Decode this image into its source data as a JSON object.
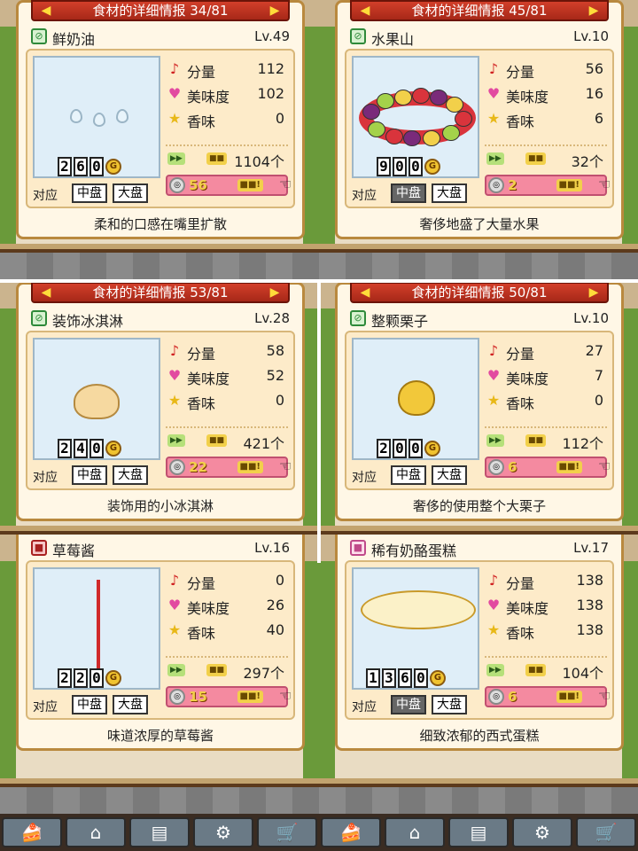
{
  "cards": [
    {
      "header": "食材的详细情报 34/81",
      "name": "鲜奶油",
      "level": "Lv.49",
      "name_icon_color": "green",
      "price_digits": [
        "2",
        "6",
        "0"
      ],
      "stats": [
        {
          "label": "分量",
          "value": "112",
          "icon": "note-icon"
        },
        {
          "label": "美味度",
          "value": "102",
          "icon": "heart-icon"
        },
        {
          "label": "香味",
          "value": "0",
          "icon": "star-icon"
        }
      ],
      "stock": "1104个",
      "medal": "56",
      "plate_label": "对应",
      "plates": [
        {
          "label": "中盘",
          "active": false
        },
        {
          "label": "大盘",
          "active": false
        }
      ],
      "description": "柔和的口感在嘴里扩散",
      "art": "cream"
    },
    {
      "header": "食材的详细情报 45/81",
      "name": "水果山",
      "level": "Lv.10",
      "name_icon_color": "green",
      "price_digits": [
        "9",
        "0",
        "0"
      ],
      "stats": [
        {
          "label": "分量",
          "value": "56",
          "icon": "note-icon"
        },
        {
          "label": "美味度",
          "value": "16",
          "icon": "heart-icon"
        },
        {
          "label": "香味",
          "value": "6",
          "icon": "star-icon"
        }
      ],
      "stock": "32个",
      "medal": "2",
      "plate_label": "对应",
      "plates": [
        {
          "label": "中盘",
          "active": true
        },
        {
          "label": "大盘",
          "active": false
        }
      ],
      "description": "奢侈地盛了大量水果",
      "art": "fruit-ring"
    },
    {
      "header": "食材的详细情报 53/81",
      "name": "装饰冰淇淋",
      "level": "Lv.28",
      "name_icon_color": "green",
      "price_digits": [
        "2",
        "4",
        "0"
      ],
      "stats": [
        {
          "label": "分量",
          "value": "58",
          "icon": "note-icon"
        },
        {
          "label": "美味度",
          "value": "52",
          "icon": "heart-icon"
        },
        {
          "label": "香味",
          "value": "0",
          "icon": "star-icon"
        }
      ],
      "stock": "421个",
      "medal": "22",
      "plate_label": "对应",
      "plates": [
        {
          "label": "中盘",
          "active": false
        },
        {
          "label": "大盘",
          "active": false
        }
      ],
      "description": "装饰用的小冰淇淋",
      "art": "ice-cream"
    },
    {
      "header": "食材的详细情报 50/81",
      "name": "整颗栗子",
      "level": "Lv.10",
      "name_icon_color": "green",
      "price_digits": [
        "2",
        "0",
        "0"
      ],
      "stats": [
        {
          "label": "分量",
          "value": "27",
          "icon": "note-icon"
        },
        {
          "label": "美味度",
          "value": "7",
          "icon": "heart-icon"
        },
        {
          "label": "香味",
          "value": "0",
          "icon": "star-icon"
        }
      ],
      "stock": "112个",
      "medal": "6",
      "plate_label": "对应",
      "plates": [
        {
          "label": "中盘",
          "active": false
        },
        {
          "label": "大盘",
          "active": false
        }
      ],
      "description": "奢侈的使用整个大栗子",
      "art": "chestnut"
    },
    {
      "header": "",
      "name": "草莓酱",
      "level": "Lv.16",
      "name_icon_color": "red",
      "price_digits": [
        "2",
        "2",
        "0"
      ],
      "stats": [
        {
          "label": "分量",
          "value": "0",
          "icon": "note-icon"
        },
        {
          "label": "美味度",
          "value": "26",
          "icon": "heart-icon"
        },
        {
          "label": "香味",
          "value": "40",
          "icon": "star-icon"
        }
      ],
      "stock": "297个",
      "medal": "15",
      "plate_label": "对应",
      "plates": [
        {
          "label": "中盘",
          "active": false
        },
        {
          "label": "大盘",
          "active": false
        }
      ],
      "description": "味道浓厚的草莓酱",
      "art": "jam"
    },
    {
      "header": "",
      "name": "稀有奶酪蛋糕",
      "level": "Lv.17",
      "name_icon_color": "pink",
      "price_digits": [
        "1",
        "3",
        "6",
        "0"
      ],
      "stats": [
        {
          "label": "分量",
          "value": "138",
          "icon": "note-icon"
        },
        {
          "label": "美味度",
          "value": "138",
          "icon": "heart-icon"
        },
        {
          "label": "香味",
          "value": "138",
          "icon": "star-icon"
        }
      ],
      "stock": "104个",
      "medal": "6",
      "plate_label": "对应",
      "plates": [
        {
          "label": "中盘",
          "active": true
        },
        {
          "label": "大盘",
          "active": false
        }
      ],
      "description": "细致浓郁的西式蛋糕",
      "art": "cheesecake"
    }
  ],
  "nav": [
    {
      "icon": "cake-icon"
    },
    {
      "icon": "shop-icon"
    },
    {
      "icon": "stall-icon"
    },
    {
      "icon": "gear-bag-icon"
    },
    {
      "icon": "cart-icon"
    },
    {
      "icon": "cake-icon"
    },
    {
      "icon": "shop-icon"
    },
    {
      "icon": "stall-icon"
    },
    {
      "icon": "gear-bag-icon"
    },
    {
      "icon": "cart-icon"
    }
  ],
  "colors": {
    "header_red": "#c2321f",
    "panel": "#fff7e6",
    "medal_pink": "#f48aa0"
  }
}
